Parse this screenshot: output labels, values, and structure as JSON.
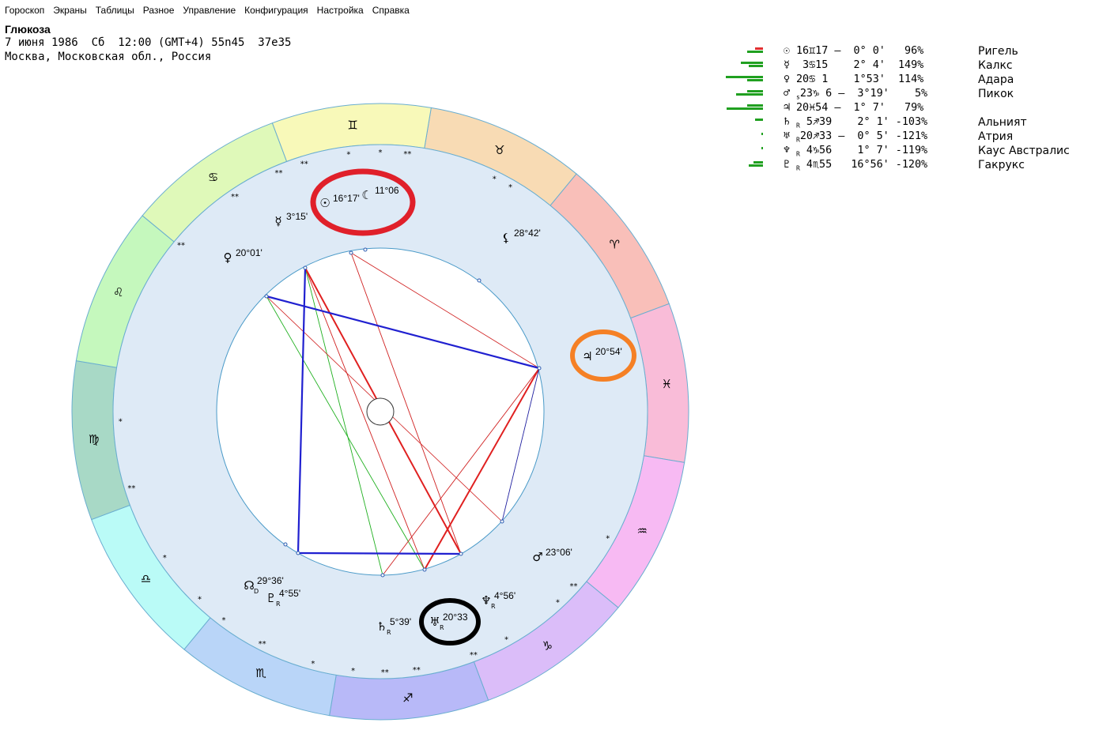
{
  "menu": [
    "Гороскоп",
    "Экраны",
    "Таблицы",
    "Разное",
    "Управление",
    "Конфигурация",
    "Настройка",
    "Справка"
  ],
  "header": {
    "title": "Глюкоза",
    "date_line": "7 июня 1986  Сб  12:00 (GMT+4) 55n45  37e35",
    "place_line": "Москва, Московская обл., Россия"
  },
  "zodiac_signs": [
    {
      "name": "taurus-icon",
      "glyph": "♉",
      "color": "#f8dbb4"
    },
    {
      "name": "aries-icon",
      "glyph": "♈",
      "color": "#f9bfb9"
    },
    {
      "name": "pisces-icon",
      "glyph": "♓",
      "color": "#f9bcd8"
    },
    {
      "name": "aquarius-icon",
      "glyph": "♒",
      "color": "#f7baf3"
    },
    {
      "name": "capricorn-icon",
      "glyph": "♑",
      "color": "#dbbdf9"
    },
    {
      "name": "sagittarius-icon",
      "glyph": "♐",
      "color": "#b8b9f8"
    },
    {
      "name": "scorpio-icon",
      "glyph": "♏",
      "color": "#b9d5f8"
    },
    {
      "name": "libra-icon",
      "glyph": "♎",
      "color": "#bafbf7"
    },
    {
      "name": "virgo-icon",
      "glyph": "♍",
      "color": "#a8d9c6"
    },
    {
      "name": "leo-icon",
      "glyph": "♌",
      "color": "#c5f8bd"
    },
    {
      "name": "cancer-icon",
      "glyph": "♋",
      "color": "#dff9b9"
    },
    {
      "name": "gemini-icon",
      "glyph": "♊",
      "color": "#f8f9b9"
    }
  ],
  "planets": [
    {
      "id": "sun",
      "glyph": "☉",
      "label": "16°17'"
    },
    {
      "id": "moon",
      "glyph": "☾",
      "label": "11°06"
    },
    {
      "id": "mercury",
      "glyph": "☿",
      "label": "3°15'"
    },
    {
      "id": "venus",
      "glyph": "♀",
      "label": "20°01'"
    },
    {
      "id": "lilith",
      "glyph": "⚸",
      "label": "28°42'"
    },
    {
      "id": "jupiter",
      "glyph": "♃",
      "label": "20°54'"
    },
    {
      "id": "mars",
      "glyph": "♂",
      "label": "23°06'"
    },
    {
      "id": "neptune",
      "glyph": "♆",
      "sub": "R",
      "label": "4°56'"
    },
    {
      "id": "uranus",
      "glyph": "♅",
      "sub": "R",
      "label": "20°33"
    },
    {
      "id": "saturn",
      "glyph": "♄",
      "sub": "R",
      "label": "5°39'"
    },
    {
      "id": "pluto",
      "glyph": "♇",
      "sub": "R",
      "label": "4°55'"
    },
    {
      "id": "node",
      "glyph": "☊",
      "sub": "D",
      "label": "29°36'"
    }
  ],
  "table": [
    {
      "glyph": "☉",
      "sub": "",
      "text": "16♊17 –  0° 0'   96%",
      "star": "Ригель",
      "bars": [
        {
          "w": 10,
          "c": "#e03030"
        },
        {
          "w": 20,
          "c": "#20a020"
        }
      ]
    },
    {
      "glyph": "☿",
      "sub": "",
      "text": " 3♋15    2° 4'  149%",
      "star": "Калкс",
      "bars": [
        {
          "w": 28,
          "c": "#20a020"
        },
        {
          "w": 18,
          "c": "#20a020"
        }
      ]
    },
    {
      "glyph": "♀",
      "sub": "",
      "text": "20♋ 1    1°53'  114%",
      "star": "Адара",
      "bars": [
        {
          "w": 62,
          "c": "#20a020"
        },
        {
          "w": 20,
          "c": "#20a020"
        }
      ]
    },
    {
      "glyph": "♂",
      "sub": "s",
      "text": "23♑ 6 –  3°19'    5%",
      "star": "Пикок",
      "bars": [
        {
          "w": 20,
          "c": "#20a020"
        },
        {
          "w": 34,
          "c": "#20a020"
        }
      ]
    },
    {
      "glyph": "♃",
      "sub": "",
      "text": "20♓54 –  1° 7'   79%",
      "star": "",
      "bars": [
        {
          "w": 20,
          "c": "#20a020"
        },
        {
          "w": 46,
          "c": "#20a020"
        }
      ]
    },
    {
      "glyph": "♄",
      "sub": "R",
      "text": " 5♐39    2° 1' -103%",
      "star": "Альният",
      "bars": [
        {
          "w": 10,
          "c": "#20a020"
        }
      ]
    },
    {
      "glyph": "♅",
      "sub": "R",
      "text": "20♐33 –  0° 5' -121%",
      "star": "Атрия",
      "bars": [
        {
          "w": 2,
          "c": "#20a020"
        }
      ]
    },
    {
      "glyph": "♆",
      "sub": "R",
      "text": " 4♑56    1° 7' -119%",
      "star": "Каус Австралис",
      "bars": [
        {
          "w": 2,
          "c": "#20a020"
        }
      ]
    },
    {
      "glyph": "♇",
      "sub": "R",
      "text": " 4♏55   16°56' -120%",
      "star": "Гакрукс",
      "bars": [
        {
          "w": 12,
          "c": "#20a020"
        },
        {
          "w": 18,
          "c": "#20a020"
        }
      ]
    }
  ],
  "highlights": [
    {
      "id": "red-circle",
      "color": "#e0202a"
    },
    {
      "id": "orange-circle",
      "color": "#f58025"
    },
    {
      "id": "black-circle",
      "color": "#000000"
    }
  ]
}
